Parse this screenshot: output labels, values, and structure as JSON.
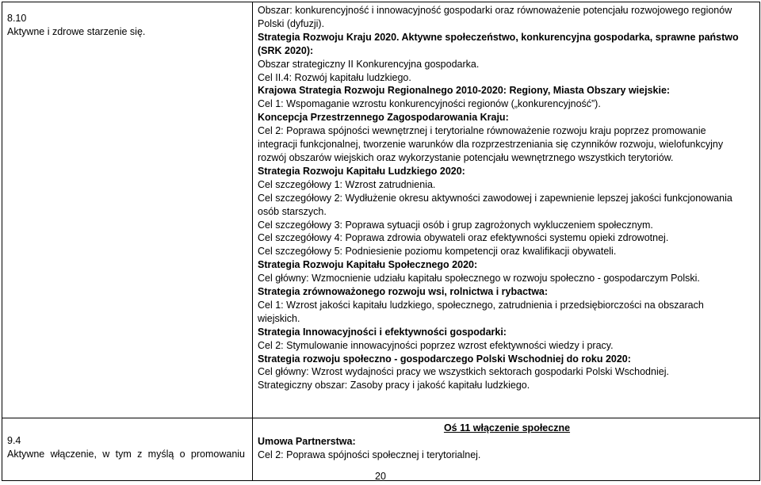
{
  "row1": {
    "left_number": "8.10",
    "left_title": "Aktywne i zdrowe starzenie się.",
    "lines": [
      {
        "text": "Obszar: konkurencyjność i innowacyjność gospodarki oraz równoważenie potencjału rozwojowego regionów",
        "style": ""
      },
      {
        "text": "Polski (dyfuzji).",
        "style": ""
      },
      {
        "text": "Strategia Rozwoju Kraju 2020. Aktywne społeczeństwo, konkurencyjna gospodarka, sprawne państwo",
        "style": "b"
      },
      {
        "text": "(SRK 2020):",
        "style": "b"
      },
      {
        "text": "Obszar strategiczny II Konkurencyjna gospodarka.",
        "style": ""
      },
      {
        "text": "Cel II.4: Rozwój kapitału ludzkiego.",
        "style": ""
      },
      {
        "text": "Krajowa Strategia Rozwoju Regionalnego 2010-2020: Regiony, Miasta Obszary wiejskie:",
        "style": "b"
      },
      {
        "text": "Cel 1: Wspomaganie wzrostu konkurencyjności regionów („konkurencyjność”).",
        "style": ""
      },
      {
        "text": "Koncepcja Przestrzennego Zagospodarowania Kraju:",
        "style": "b"
      },
      {
        "text": "Cel 2: Poprawa spójności wewnętrznej i terytorialne równoważenie rozwoju kraju poprzez promowanie",
        "style": ""
      },
      {
        "text": "integracji funkcjonalnej, tworzenie warunków dla rozprzestrzeniania się czynników rozwoju, wielofunkcyjny",
        "style": ""
      },
      {
        "text": "rozwój obszarów wiejskich oraz wykorzystanie potencjału wewnętrznego wszystkich terytoriów.",
        "style": ""
      },
      {
        "text": "Strategia Rozwoju Kapitału Ludzkiego 2020:",
        "style": "b"
      },
      {
        "text": "Cel szczegółowy 1: Wzrost zatrudnienia.",
        "style": ""
      },
      {
        "text": "Cel szczegółowy 2: Wydłużenie okresu aktywności zawodowej i zapewnienie lepszej jakości funkcjonowania",
        "style": ""
      },
      {
        "text": "osób starszych.",
        "style": ""
      },
      {
        "text": "Cel szczegółowy 3: Poprawa sytuacji osób i grup zagrożonych wykluczeniem społecznym.",
        "style": ""
      },
      {
        "text": "Cel szczegółowy 4: Poprawa zdrowia obywateli oraz efektywności systemu opieki zdrowotnej.",
        "style": ""
      },
      {
        "text": "Cel szczegółowy 5: Podniesienie poziomu kompetencji oraz kwalifikacji obywateli.",
        "style": ""
      },
      {
        "text": "Strategia Rozwoju Kapitału Społecznego 2020:",
        "style": "b"
      },
      {
        "text": "Cel główny: Wzmocnienie udziału kapitału społecznego w rozwoju społeczno - gospodarczym Polski.",
        "style": ""
      },
      {
        "text": "Strategia zrównoważonego rozwoju wsi, rolnictwa i rybactwa:",
        "style": "b"
      },
      {
        "text": "Cel 1: Wzrost jakości kapitału ludzkiego, społecznego, zatrudnienia i przedsiębiorczości na obszarach",
        "style": ""
      },
      {
        "text": "wiejskich.",
        "style": ""
      },
      {
        "text": "Strategia Innowacyjności i efektywności gospodarki:",
        "style": "b"
      },
      {
        "text": "Cel 2:  Stymulowanie innowacyjności poprzez wzrost efektywności wiedzy i pracy.",
        "style": ""
      },
      {
        "text": "Strategia rozwoju społeczno - gospodarczego Polski Wschodniej do roku 2020:",
        "style": "b"
      },
      {
        "text": "Cel główny: Wzrost wydajności pracy we wszystkich sektorach gospodarki Polski Wschodniej.",
        "style": ""
      },
      {
        "text": "Strategiczny obszar: Zasoby pracy i jakość kapitału ludzkiego.",
        "style": ""
      }
    ]
  },
  "row2": {
    "left_number": "9.4",
    "left_title": "Aktywne włączenie, w tym z myślą o promowaniu",
    "heading": "Oś 11 włączenie społeczne",
    "partnership_label": "Umowa Partnerstwa:",
    "goal": "Cel 2: Poprawa spójności społecznej i terytorialnej."
  },
  "footer": {
    "page_number": "20"
  }
}
